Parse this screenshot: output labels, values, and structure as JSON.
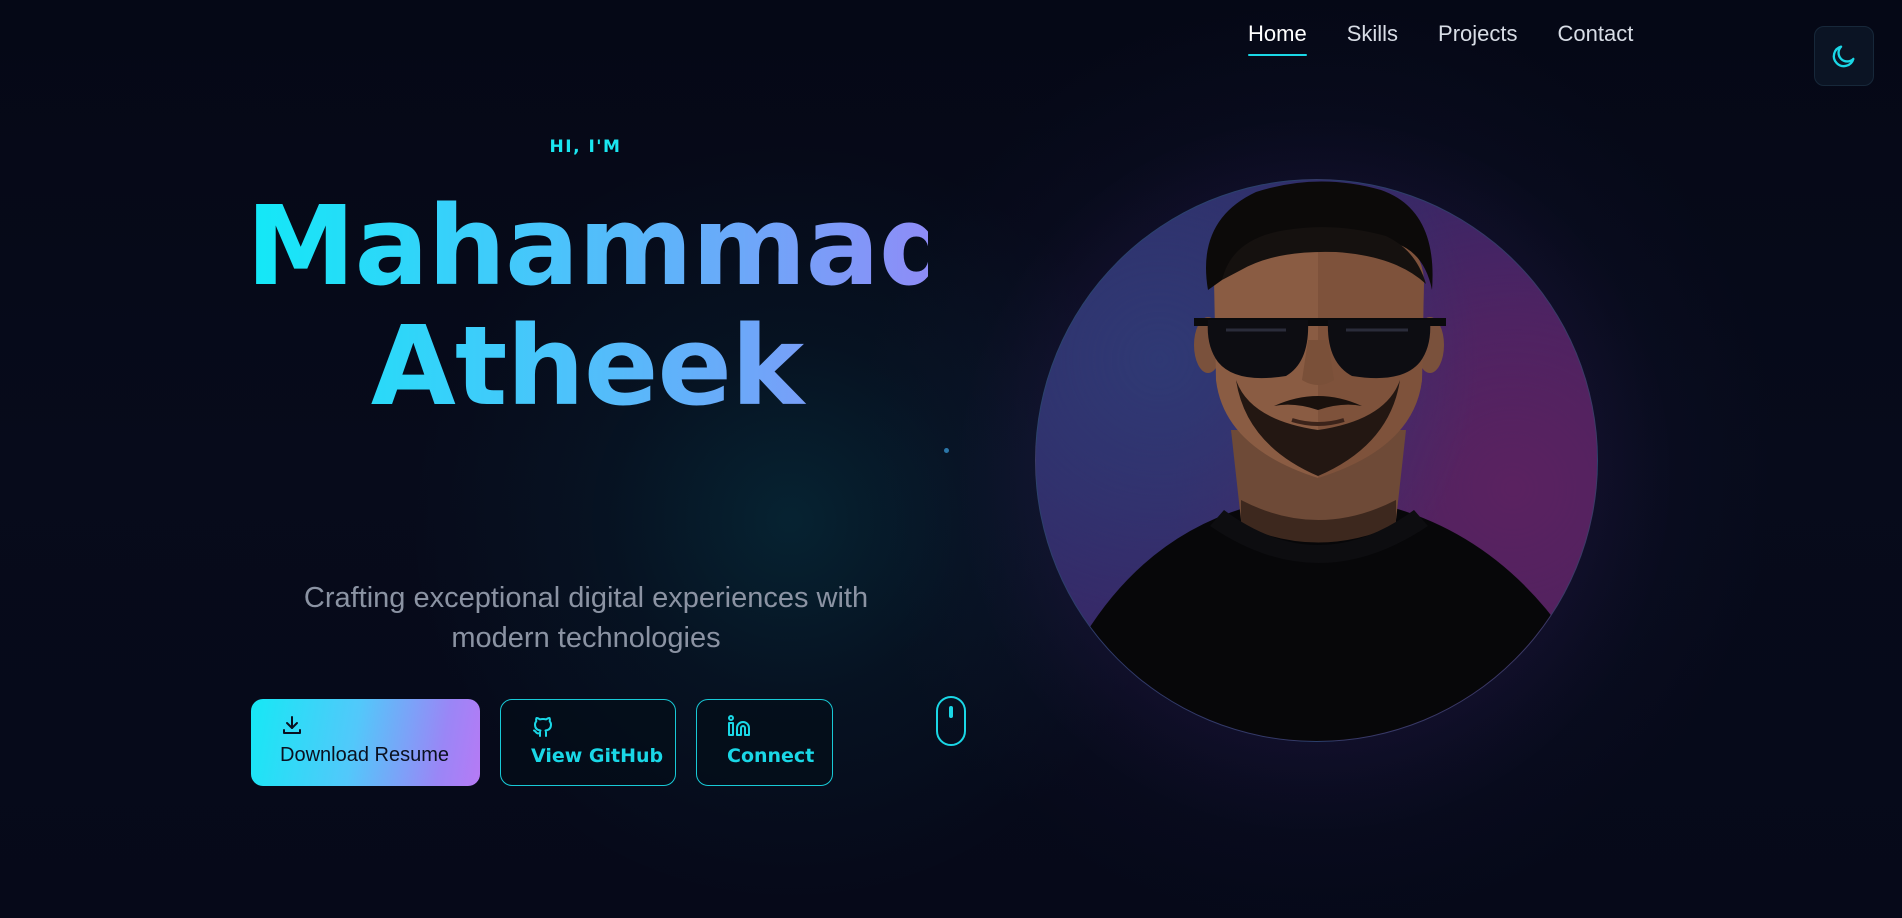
{
  "nav": {
    "items": [
      {
        "label": "Home",
        "active": true
      },
      {
        "label": "Skills",
        "active": false
      },
      {
        "label": "Projects",
        "active": false
      },
      {
        "label": "Contact",
        "active": false
      }
    ]
  },
  "theme_toggle": {
    "icon": "moon-icon"
  },
  "hero": {
    "eyebrow": "HI, I'M",
    "name_line1": "Mahammad",
    "name_line2": "Atheek",
    "tagline_line1": "Crafting exceptional digital experiences with",
    "tagline_line2": "modern technologies"
  },
  "buttons": {
    "download": {
      "label": "Download Resume",
      "icon": "download-icon"
    },
    "github": {
      "label": "View GitHub",
      "icon": "github-icon"
    },
    "connect": {
      "label": "Connect",
      "icon": "linkedin-icon"
    }
  },
  "scroll_indicator": {
    "icon": "mouse-scroll-icon"
  },
  "avatar": {
    "description_icon": "profile-photo"
  },
  "colors": {
    "accent": "#1ad7e6",
    "gradient_start": "#12e9f7",
    "gradient_end": "#9a86f6",
    "background": "#060a18"
  }
}
